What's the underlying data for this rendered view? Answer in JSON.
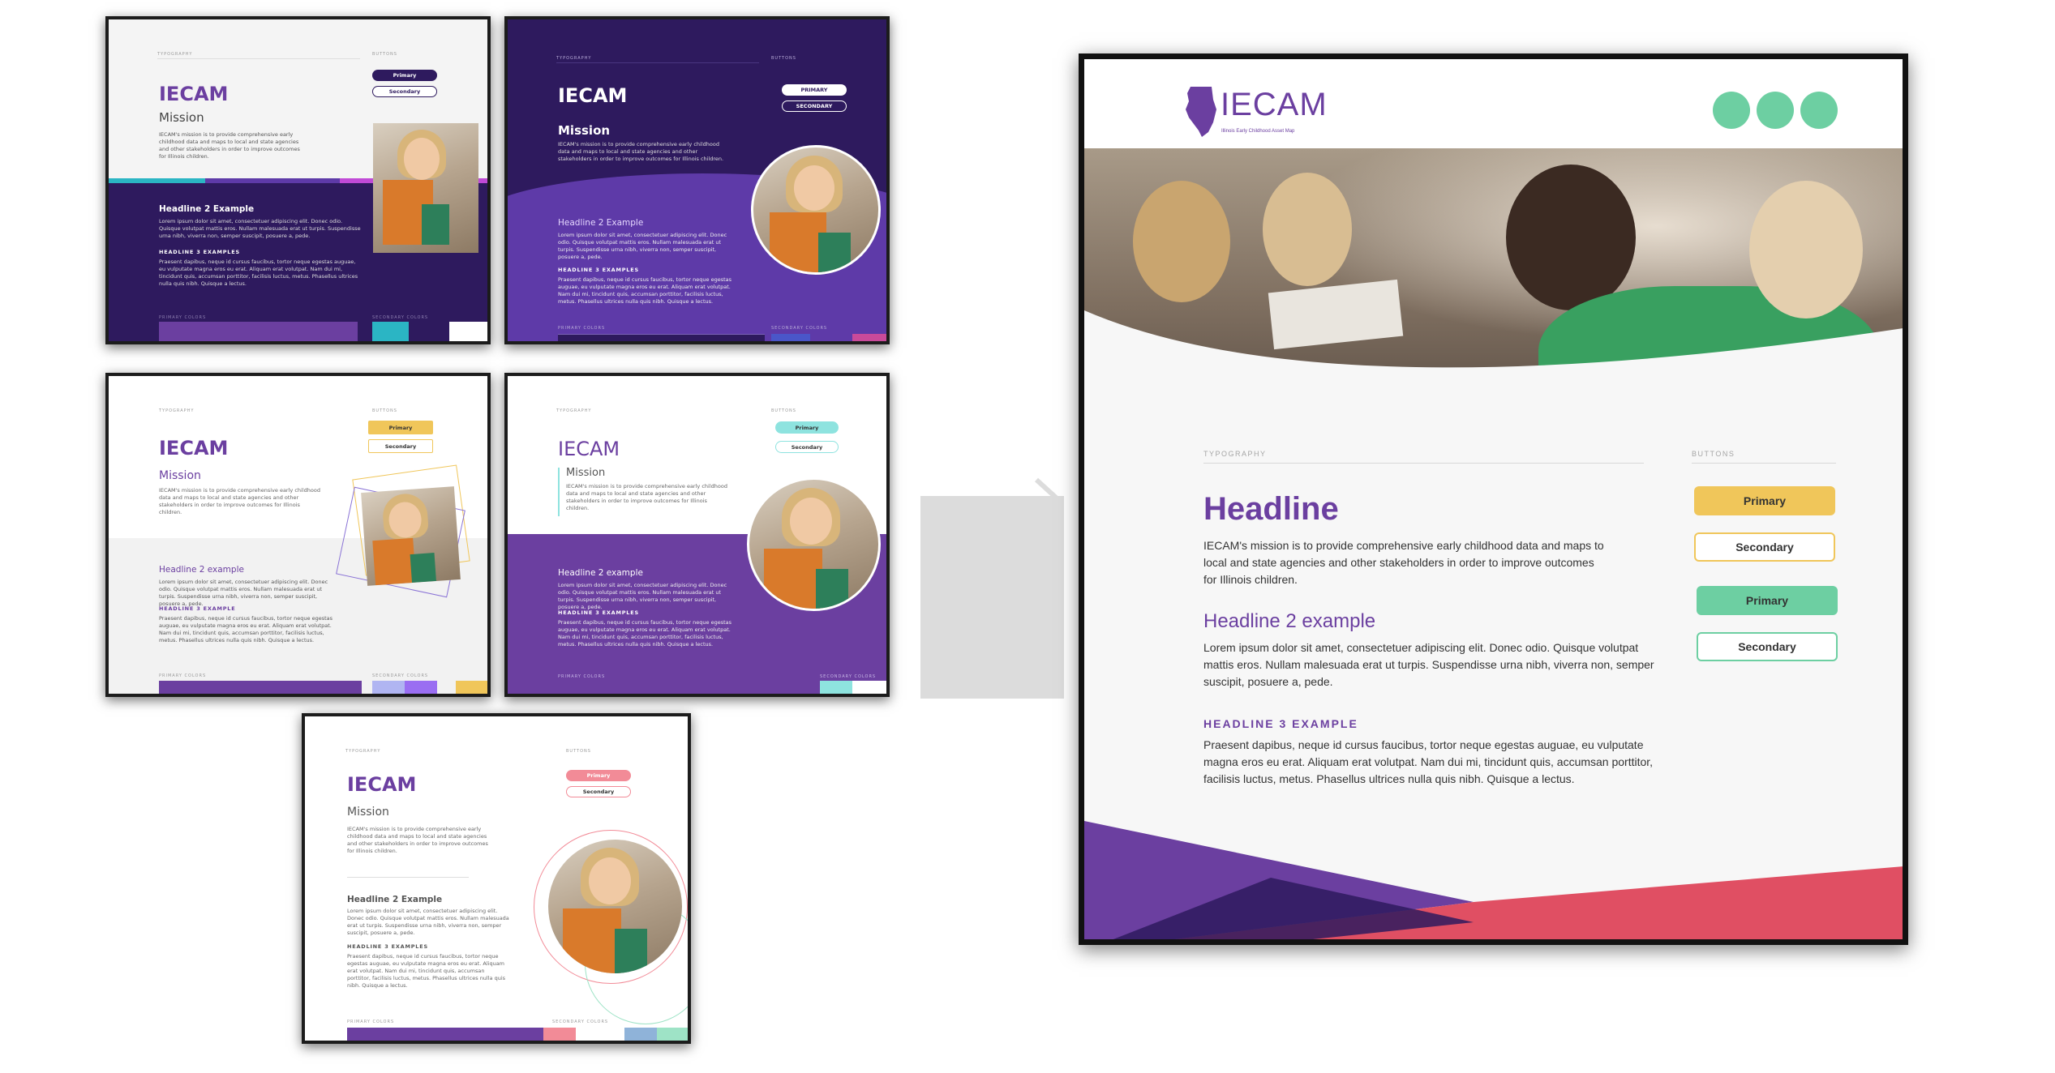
{
  "colors": {
    "purple": "#6b3fa0",
    "dark_purple": "#2e1a5e",
    "violet": "#5e3aa8",
    "teal": "#2bb5c4",
    "mint": "#6dcfa2",
    "yellow": "#f0c65a",
    "coral": "#e04f63",
    "pink": "#f28b97",
    "aqua": "#8ee3df"
  },
  "variants": [
    {
      "typography": "TYPOGRAPHY",
      "buttons": "BUTTONS",
      "title": "IECAM",
      "mission": "Mission",
      "mission_text": "IECAM's mission is to provide comprehensive early childhood data and maps to local and state agencies and other stakeholders in order to improve outcomes for Illinois children.",
      "h2": "Headline 2 Example",
      "h2_text": "Lorem ipsum dolor sit amet, consectetuer adipiscing elit. Donec odio. Quisque volutpat mattis eros. Nullam malesuada erat ut turpis. Suspendisse urna nibh, viverra non, semper suscipit, posuere a, pede.",
      "h3": "HEADLINE 3 EXAMPLES",
      "h3_text": "Praesent dapibus, neque id cursus faucibus, tortor neque egestas auguae, eu vulputate magna eros eu erat. Aliquam erat volutpat. Nam dui mi, tincidunt quis, accumsan porttitor, facilisis luctus, metus. Phasellus ultrices nulla quis nibh. Quisque a lectus.",
      "primary": "Primary",
      "secondary": "Secondary",
      "primary_colors": "PRIMARY COLORS",
      "secondary_colors": "SECONDARY COLORS"
    },
    {
      "typography": "TYPOGRAPHY",
      "buttons": "BUTTONS",
      "title": "IECAM",
      "mission": "Mission",
      "mission_text": "IECAM's mission is to provide comprehensive early childhood data and maps to local and state agencies and other stakeholders in order to improve outcomes for Illinois children.",
      "h2": "Headline 2 Example",
      "h2_text": "Lorem ipsum dolor sit amet, consectetuer adipiscing elit. Donec odio. Quisque volutpat mattis eros. Nullam malesuada erat ut turpis. Suspendisse urna nibh, viverra non, semper suscipit, posuere a, pede.",
      "h3": "HEADLINE 3 EXAMPLES",
      "h3_text": "Praesent dapibus, neque id cursus faucibus, tortor neque egestas auguae, eu vulputate magna eros eu erat. Aliquam erat volutpat. Nam dui mi, tincidunt quis, accumsan porttitor, facilisis luctus, metus. Phasellus ultrices nulla quis nibh. Quisque a lectus.",
      "primary": "PRIMARY",
      "secondary": "SECONDARY",
      "primary_colors": "PRIMARY COLORS",
      "secondary_colors": "SECONDARY COLORS"
    },
    {
      "typography": "TYPOGRAPHY",
      "buttons": "BUTTONS",
      "title": "IECAM",
      "mission": "Mission",
      "mission_text": "IECAM's mission is to provide comprehensive early childhood data and maps to local and state agencies and other stakeholders in order to improve outcomes for Illinois children.",
      "h2": "Headline 2 example",
      "h2_text": "Lorem ipsum dolor sit amet, consectetuer adipiscing elit. Donec odio. Quisque volutpat mattis eros. Nullam malesuada erat ut turpis. Suspendisse urna nibh, viverra non, semper suscipit, posuere a, pede.",
      "h3": "HEADLINE 3 EXAMPLE",
      "h3_text": "Praesent dapibus, neque id cursus faucibus, tortor neque egestas auguae, eu vulputate magna eros eu erat. Aliquam erat volutpat. Nam dui mi, tincidunt quis, accumsan porttitor, facilisis luctus, metus. Phasellus ultrices nulla quis nibh. Quisque a lectus.",
      "primary": "Primary",
      "secondary": "Secondary",
      "primary_colors": "PRIMARY COLORS",
      "secondary_colors": "SECONDARY COLORS"
    },
    {
      "typography": "TYPOGRAPHY",
      "buttons": "BUTTONS",
      "title": "IECAM",
      "mission": "Mission",
      "mission_text": "IECAM's mission is to provide comprehensive early childhood data and maps to local and state agencies and other stakeholders in order to improve outcomes for Illinois children.",
      "h2": "Headline 2 example",
      "h2_text": "Lorem ipsum dolor sit amet, consectetuer adipiscing elit. Donec odio. Quisque volutpat mattis eros. Nullam malesuada erat ut turpis. Suspendisse urna nibh, viverra non, semper suscipit, posuere a, pede.",
      "h3": "HEADLINE 3 EXAMPLES",
      "h3_text": "Praesent dapibus, neque id cursus faucibus, tortor neque egestas auguae, eu vulputate magna eros eu erat. Aliquam erat volutpat. Nam dui mi, tincidunt quis, accumsan porttitor, facilisis luctus, metus. Phasellus ultrices nulla quis nibh. Quisque a lectus.",
      "primary": "Primary",
      "secondary": "Secondary",
      "primary_colors": "PRIMARY COLORS",
      "secondary_colors": "SECONDARY COLORS"
    },
    {
      "typography": "TYPOGRAPHY",
      "buttons": "BUTTONS",
      "title": "IECAM",
      "mission": "Mission",
      "mission_text": "IECAM's mission is to provide comprehensive early childhood data and maps to local and state agencies and other stakeholders in order to improve outcomes for Illinois children.",
      "h2": "Headline 2 Example",
      "h2_text": "Lorem ipsum dolor sit amet, consectetuer adipiscing elit. Donec odio. Quisque volutpat mattis eros. Nullam malesuada erat ut turpis. Suspendisse urna nibh, viverra non, semper suscipit, posuere a, pede.",
      "h3": "HEADLINE 3 EXAMPLES",
      "h3_text": "Praesent dapibus, neque id cursus faucibus, tortor neque egestas auguae, eu vulputate magna eros eu erat. Aliquam erat volutpat. Nam dui mi, tincidunt quis, accumsan porttitor, facilisis luctus, metus. Phasellus ultrices nulla quis nibh. Quisque a lectus.",
      "primary": "Primary",
      "secondary": "Secondary",
      "primary_colors": "PRIMARY COLORS",
      "secondary_colors": "SECONDARY COLORS"
    }
  ],
  "main": {
    "logo_text": "IECAM",
    "logo_tagline": "Illinois Early Childhood Asset Map",
    "typography_label": "TYPOGRAPHY",
    "buttons_label": "BUTTONS",
    "headline": "Headline",
    "mission_lines": [
      "IECAM's mission is to provide comprehensive early childhood data and maps to",
      "local and state agencies and other stakeholders in order to improve outcomes",
      "for Illinois children."
    ],
    "h2": "Headline 2 example",
    "h2_lines": [
      "Lorem ipsum dolor sit amet, consectetuer adipiscing elit. Donec odio. Quisque volutpat",
      "mattis eros. Nullam malesuada erat ut turpis. Suspendisse urna nibh, viverra non, semper",
      "suscipit, posuere a, pede."
    ],
    "h3": "HEADLINE 3 EXAMPLE",
    "h3_lines": [
      "Praesent dapibus, neque id cursus faucibus, tortor neque egestas auguae, eu vulputate",
      "magna eros eu erat. Aliquam erat volutpat. Nam dui mi, tincidunt quis, accumsan porttitor,",
      "facilisis luctus, metus. Phasellus ultrices nulla quis nibh. Quisque a lectus."
    ],
    "buttons": {
      "primary_yellow": "Primary",
      "secondary_yellow": "Secondary",
      "primary_mint": "Primary",
      "secondary_mint": "Secondary"
    }
  }
}
